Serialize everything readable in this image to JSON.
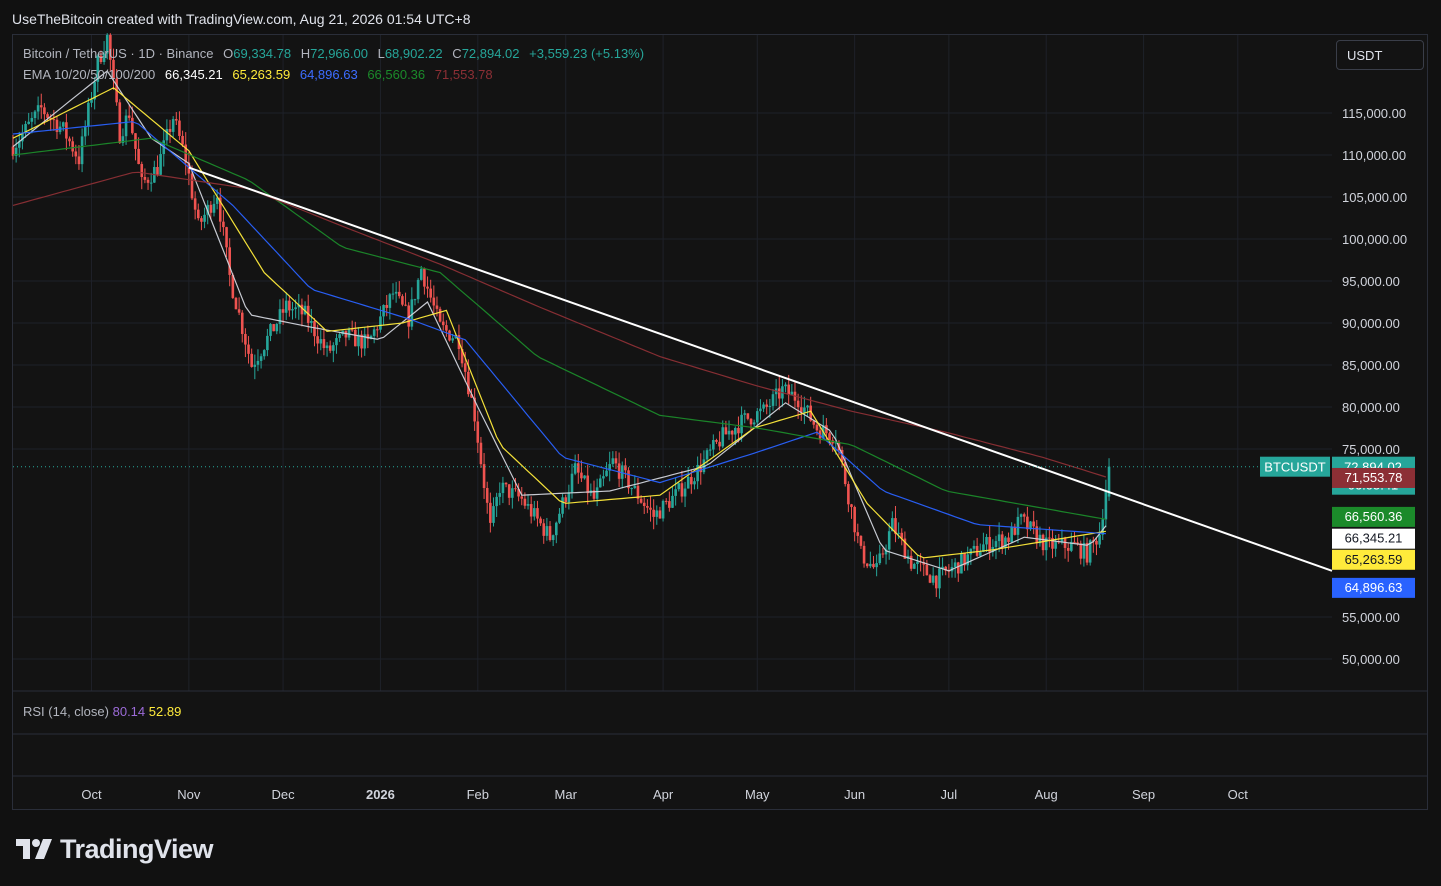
{
  "header": {
    "credit": "UseTheBitcoin created with TradingView.com, Aug 21, 2026 01:54 UTC+8"
  },
  "legend": {
    "symbol": "Bitcoin / TetherUS · 1D · Binance",
    "o_label": "O",
    "o": "69,334.78",
    "h_label": "H",
    "h": "72,966.00",
    "l_label": "L",
    "l": "68,902.22",
    "c_label": "C",
    "c": "72,894.02",
    "change": "+3,559.23 (+5.13%)",
    "ema_label": "EMA 10/20/50/100/200",
    "ema10": "66,345.21",
    "ema20": "65,263.59",
    "ema50": "64,896.63",
    "ema100": "66,560.36",
    "ema200": "71,553.78"
  },
  "currency_button": "USDT",
  "rsi": {
    "label": "RSI (14, close)",
    "value": "80.14",
    "ma": "52.89"
  },
  "price_labels": {
    "symbol_tag": "BTCUSDT",
    "last": "72,894.02",
    "countdown": "06:05:41",
    "ema200": "71,553.78",
    "ema100": "66,560.36",
    "ema10": "66,345.21",
    "ema20": "65,263.59",
    "ema50": "64,896.63"
  },
  "colors": {
    "up": "#26a69a",
    "down": "#ef5350",
    "ema10": "#d1d4dc",
    "ema20": "#ffeb3b",
    "ema50": "#2962ff",
    "ema100": "#1b8a2a",
    "ema200": "#8c2f35",
    "trendline": "#ffffff"
  },
  "logo": {
    "icon": "tradingview-logo-icon",
    "text": "TradingView"
  },
  "chart_data": {
    "type": "candlestick",
    "title": "Bitcoin / TetherUS · 1D · Binance",
    "y_ticks": [
      115000,
      110000,
      105000,
      100000,
      95000,
      90000,
      85000,
      80000,
      75000,
      55000,
      50000
    ],
    "y_tick_labels": [
      "115,000.00",
      "110,000.00",
      "105,000.00",
      "100,000.00",
      "95,000.00",
      "90,000.00",
      "85,000.00",
      "80,000.00",
      "75,000.00",
      "55,000.00",
      "50,000.00"
    ],
    "ylim": [
      45000,
      124000
    ],
    "x_tick_labels": [
      "Oct",
      "Nov",
      "Dec",
      "2026",
      "Feb",
      "Mar",
      "Apr",
      "May",
      "Jun",
      "Jul",
      "Aug",
      "Sep",
      "Oct"
    ],
    "x_ticks": [
      "2025-10-01",
      "2025-11-01",
      "2025-12-01",
      "2026-01-01",
      "2026-02-01",
      "2026-03-01",
      "2026-04-01",
      "2026-05-01",
      "2026-06-01",
      "2026-07-01",
      "2026-08-01",
      "2026-09-01",
      "2026-10-01"
    ],
    "x_range": [
      "2025-09-06",
      "2026-10-31"
    ],
    "close_path": [
      [
        "2025-09-06",
        111000
      ],
      [
        "2025-09-15",
        115500
      ],
      [
        "2025-09-22",
        113000
      ],
      [
        "2025-09-27",
        109500
      ],
      [
        "2025-10-03",
        121000
      ],
      [
        "2025-10-06",
        124000
      ],
      [
        "2025-10-10",
        112500
      ],
      [
        "2025-10-13",
        115000
      ],
      [
        "2025-10-17",
        106500
      ],
      [
        "2025-10-22",
        108500
      ],
      [
        "2025-10-27",
        114500
      ],
      [
        "2025-10-31",
        109500
      ],
      [
        "2025-11-04",
        101500
      ],
      [
        "2025-11-10",
        105500
      ],
      [
        "2025-11-14",
        95500
      ],
      [
        "2025-11-21",
        85000
      ],
      [
        "2025-11-25",
        87500
      ],
      [
        "2025-12-02",
        92000
      ],
      [
        "2025-12-08",
        91000
      ],
      [
        "2025-12-15",
        86500
      ],
      [
        "2025-12-21",
        88500
      ],
      [
        "2025-12-28",
        87500
      ],
      [
        "2026-01-05",
        93500
      ],
      [
        "2026-01-10",
        90500
      ],
      [
        "2026-01-14",
        96500
      ],
      [
        "2026-01-20",
        89500
      ],
      [
        "2026-01-26",
        88000
      ],
      [
        "2026-01-31",
        79000
      ],
      [
        "2026-02-05",
        65500
      ],
      [
        "2026-02-08",
        70500
      ],
      [
        "2026-02-15",
        69000
      ],
      [
        "2026-02-24",
        64500
      ],
      [
        "2026-03-04",
        72500
      ],
      [
        "2026-03-10",
        69000
      ],
      [
        "2026-03-16",
        73500
      ],
      [
        "2026-03-22",
        70500
      ],
      [
        "2026-03-29",
        67000
      ],
      [
        "2026-04-05",
        69500
      ],
      [
        "2026-04-12",
        72500
      ],
      [
        "2026-04-20",
        76500
      ],
      [
        "2026-04-27",
        78500
      ],
      [
        "2026-05-03",
        79500
      ],
      [
        "2026-05-09",
        82000
      ],
      [
        "2026-05-14",
        81000
      ],
      [
        "2026-05-20",
        77500
      ],
      [
        "2026-05-26",
        76500
      ],
      [
        "2026-06-03",
        62500
      ],
      [
        "2026-06-08",
        60500
      ],
      [
        "2026-06-13",
        66000
      ],
      [
        "2026-06-19",
        61500
      ],
      [
        "2026-06-27",
        59500
      ],
      [
        "2026-07-05",
        61500
      ],
      [
        "2026-07-12",
        63500
      ],
      [
        "2026-07-20",
        64500
      ],
      [
        "2026-07-24",
        66500
      ],
      [
        "2026-08-01",
        63500
      ],
      [
        "2026-08-10",
        63500
      ],
      [
        "2026-08-14",
        62500
      ],
      [
        "2026-08-18",
        65000
      ],
      [
        "2026-08-21",
        72894.02
      ]
    ],
    "series": [
      {
        "name": "EMA 10",
        "last": 66345.21,
        "values": [
          [
            "2025-09-06",
            111000
          ],
          [
            "2025-10-06",
            120000
          ],
          [
            "2025-10-20",
            112000
          ],
          [
            "2025-11-01",
            109000
          ],
          [
            "2025-11-20",
            91000
          ],
          [
            "2025-12-10",
            89500
          ],
          [
            "2026-01-01",
            88000
          ],
          [
            "2026-01-16",
            92500
          ],
          [
            "2026-02-01",
            80000
          ],
          [
            "2026-02-15",
            69500
          ],
          [
            "2026-03-15",
            70000
          ],
          [
            "2026-04-15",
            73000
          ],
          [
            "2026-05-10",
            80500
          ],
          [
            "2026-05-25",
            77000
          ],
          [
            "2026-06-10",
            63000
          ],
          [
            "2026-07-01",
            60500
          ],
          [
            "2026-07-25",
            64500
          ],
          [
            "2026-08-15",
            63500
          ],
          [
            "2026-08-21",
            66345.21
          ]
        ]
      },
      {
        "name": "EMA 20",
        "last": 65263.59,
        "values": [
          [
            "2025-09-06",
            112000
          ],
          [
            "2025-10-08",
            118000
          ],
          [
            "2025-11-01",
            110500
          ],
          [
            "2025-11-25",
            96000
          ],
          [
            "2025-12-15",
            89000
          ],
          [
            "2026-01-08",
            90000
          ],
          [
            "2026-01-22",
            91500
          ],
          [
            "2026-02-08",
            75500
          ],
          [
            "2026-02-28",
            68500
          ],
          [
            "2026-03-31",
            69500
          ],
          [
            "2026-04-30",
            77500
          ],
          [
            "2026-05-18",
            79500
          ],
          [
            "2026-06-05",
            68500
          ],
          [
            "2026-06-22",
            62000
          ],
          [
            "2026-07-15",
            63000
          ],
          [
            "2026-08-21",
            65263.59
          ]
        ]
      },
      {
        "name": "EMA 50",
        "last": 64896.63,
        "values": [
          [
            "2025-09-06",
            112500
          ],
          [
            "2025-10-15",
            114000
          ],
          [
            "2025-11-15",
            104000
          ],
          [
            "2025-12-10",
            94000
          ],
          [
            "2026-01-10",
            90500
          ],
          [
            "2026-01-28",
            88000
          ],
          [
            "2026-02-28",
            74000
          ],
          [
            "2026-03-31",
            71000
          ],
          [
            "2026-04-30",
            74500
          ],
          [
            "2026-05-20",
            77000
          ],
          [
            "2026-06-10",
            70000
          ],
          [
            "2026-07-10",
            66000
          ],
          [
            "2026-08-21",
            64896.63
          ]
        ]
      },
      {
        "name": "EMA 100",
        "last": 66560.36,
        "values": [
          [
            "2025-09-06",
            110000
          ],
          [
            "2025-10-20",
            112000
          ],
          [
            "2025-11-20",
            107000
          ],
          [
            "2025-12-20",
            99000
          ],
          [
            "2026-01-20",
            96000
          ],
          [
            "2026-02-20",
            86000
          ],
          [
            "2026-03-31",
            79000
          ],
          [
            "2026-05-01",
            77500
          ],
          [
            "2026-05-31",
            75500
          ],
          [
            "2026-06-30",
            70000
          ],
          [
            "2026-08-21",
            66560.36
          ]
        ]
      },
      {
        "name": "EMA 200",
        "last": 71553.78,
        "values": [
          [
            "2025-09-06",
            104000
          ],
          [
            "2025-10-15",
            108000
          ],
          [
            "2025-11-20",
            106000
          ],
          [
            "2025-12-20",
            101500
          ],
          [
            "2026-01-20",
            97000
          ],
          [
            "2026-02-20",
            92000
          ],
          [
            "2026-03-31",
            86000
          ],
          [
            "2026-05-01",
            82500
          ],
          [
            "2026-05-31",
            79500
          ],
          [
            "2026-06-30",
            77000
          ],
          [
            "2026-07-31",
            74000
          ],
          [
            "2026-08-21",
            71553.78
          ]
        ]
      }
    ],
    "trendline": [
      [
        "2025-11-01",
        108500
      ],
      [
        "2026-10-31",
        60500
      ]
    ],
    "last_price": 72894.02,
    "grid": true,
    "legend_position": "top-left"
  }
}
